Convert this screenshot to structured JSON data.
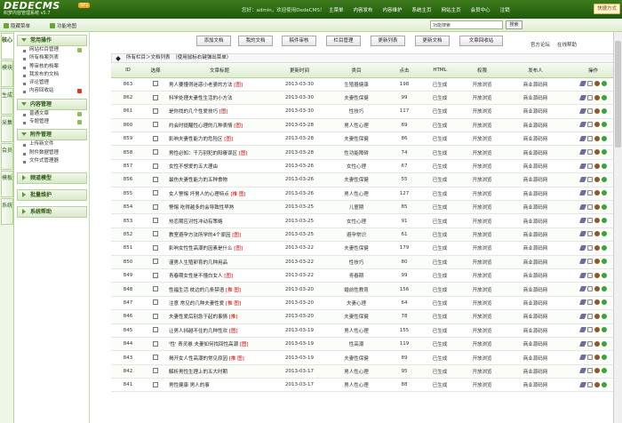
{
  "app": {
    "logo_main": "DEDECMS",
    "logo_sub": "织梦内容管理系统 v5.7",
    "logo_badge": "SP1"
  },
  "header": {
    "welcome": "您好：admin，欢迎使用DedeCMS！",
    "nav": [
      "主菜单",
      "内容发布",
      "内容维护",
      "系统主页",
      "网站主页",
      "会员中心",
      "注销"
    ],
    "quick_label": "快捷方式"
  },
  "subbar": {
    "hide_menu": "隐藏菜单",
    "function_map": "功能地图",
    "search_value": "功能搜索",
    "search_button": "搜索",
    "official_forum": "官方论坛",
    "dede_wiki": "在线帮助"
  },
  "vtabs": [
    "核心",
    "模块",
    "生成",
    "采集",
    "会员",
    "模板",
    "系统"
  ],
  "sidebar": {
    "sections": [
      {
        "title": "常用操作",
        "items": [
          "网站栏目管理",
          "所有档案列表",
          "等审核的档案",
          "我发布的文档",
          "评论管理",
          "内容回收站"
        ]
      },
      {
        "title": "内容管理",
        "items": [
          "普通文章",
          "专题管理"
        ]
      },
      {
        "title": "附件管理",
        "items": [
          "上传新文件",
          "附件数据管理",
          "文件式管理器"
        ]
      },
      {
        "title": "频道模型",
        "items": []
      },
      {
        "title": "批量维护",
        "items": []
      },
      {
        "title": "系统帮助",
        "items": []
      }
    ]
  },
  "toolbar": {
    "buttons": [
      "添加文档",
      "我的文档",
      "稿件审核",
      "栏目管理",
      "更新列表",
      "更新文档",
      "文章回收站"
    ]
  },
  "crumb": "所有栏目＞文档列表　（使用鼠标右键弹出菜单）",
  "table": {
    "headers": [
      "ID",
      "选择",
      "文章标题",
      "更新时间",
      "类目",
      "点击",
      "HTML",
      "权限",
      "发布人",
      "操作"
    ],
    "rows": [
      {
        "id": "863",
        "title": "男人要懂得迷惑小老婆的方法",
        "flag": "[图]",
        "date": "2013-03-30",
        "cat": "生殖器健康",
        "hits": "198",
        "html": "已生成",
        "perm": "开放浏览",
        "author": "商业源码网"
      },
      {
        "id": "862",
        "title": "科学处理夫妻性生活的小方法",
        "flag": "",
        "date": "2013-03-30",
        "cat": "夫妻性保健",
        "hits": "99",
        "html": "已生成",
        "perm": "开放浏览",
        "author": "商业源码网"
      },
      {
        "id": "861",
        "title": "是你找的几个性爱技巧",
        "flag": "[图]",
        "date": "2013-03-30",
        "cat": "性技巧",
        "hits": "117",
        "html": "已生成",
        "perm": "开放浏览",
        "author": "商业源码网"
      },
      {
        "id": "860",
        "title": "约会时提醒性心理的几种表情",
        "flag": "[图]",
        "date": "2013-03-28",
        "cat": "男人性心理",
        "hits": "69",
        "html": "已生成",
        "perm": "开放浏览",
        "author": "商业源码网"
      },
      {
        "id": "859",
        "title": "影响夫妻性能力的危险区",
        "flag": "[图]",
        "date": "2013-03-28",
        "cat": "夫妻性保健",
        "hits": "86",
        "html": "已生成",
        "perm": "开放浏览",
        "author": "商业源码网"
      },
      {
        "id": "858",
        "title": "男性必知：千万别犯的阳痿误区",
        "flag": "[图]",
        "date": "2013-03-28",
        "cat": "性功能障碍",
        "hits": "74",
        "html": "已生成",
        "perm": "开放浏览",
        "author": "商业源码网"
      },
      {
        "id": "857",
        "title": "女性不想爱的五大理由",
        "flag": "",
        "date": "2013-03-26",
        "cat": "女性心理",
        "hits": "67",
        "html": "已生成",
        "perm": "开放浏览",
        "author": "商业源码网"
      },
      {
        "id": "856",
        "title": "最伤夫妻性能力的五种食物",
        "flag": "",
        "date": "2013-03-26",
        "cat": "夫妻性保健",
        "hits": "55",
        "html": "已生成",
        "perm": "开放浏览",
        "author": "商业源码网"
      },
      {
        "id": "855",
        "title": "女人警惕 坏男人的心理特点",
        "flag": "[推 图]",
        "date": "2013-03-26",
        "cat": "男人性心理",
        "hits": "127",
        "html": "已生成",
        "perm": "开放浏览",
        "author": "商业源码网"
      },
      {
        "id": "854",
        "title": "警惕 吃得越多的会导致性早熟",
        "flag": "",
        "date": "2013-03-25",
        "cat": "儿童期",
        "hits": "85",
        "html": "已生成",
        "perm": "开放浏览",
        "author": "商业源码网"
      },
      {
        "id": "853",
        "title": "热恋期应对性冲动有策略",
        "flag": "",
        "date": "2013-03-25",
        "cat": "女性心理",
        "hits": "91",
        "html": "已生成",
        "perm": "开放浏览",
        "author": "商业源码网"
      },
      {
        "id": "852",
        "title": "教室避孕方法所学的4个原因",
        "flag": "[图]",
        "date": "2013-03-25",
        "cat": "避孕常识",
        "hits": "61",
        "html": "已生成",
        "perm": "开放浏览",
        "author": "商业源码网"
      },
      {
        "id": "851",
        "title": "影响女性性高潮的因素是什么",
        "flag": "[图]",
        "date": "2013-03-22",
        "cat": "夫妻性保健",
        "hits": "179",
        "html": "已生成",
        "perm": "开放浏览",
        "author": "商业源码网"
      },
      {
        "id": "850",
        "title": "谨男人生殖卵育的几种用品",
        "flag": "",
        "date": "2013-03-22",
        "cat": "性技巧",
        "hits": "80",
        "html": "已生成",
        "perm": "开放浏览",
        "author": "商业源码网"
      },
      {
        "id": "849",
        "title": "青春期女性是不懂白女人",
        "flag": "[图]",
        "date": "2013-03-22",
        "cat": "青春期",
        "hits": "99",
        "html": "已生成",
        "perm": "开放浏览",
        "author": "商业源码网"
      },
      {
        "id": "848",
        "title": "性福生活 枕边的几条禁语",
        "flag": "[推 图]",
        "date": "2013-03-20",
        "cat": "婚前性教育",
        "hits": "156",
        "html": "已生成",
        "perm": "开放浏览",
        "author": "商业源码网"
      },
      {
        "id": "847",
        "title": "注意 常见的几种夫妻性爱",
        "flag": "[推 图]",
        "date": "2013-03-20",
        "cat": "夫妻心理",
        "hits": "64",
        "html": "已生成",
        "perm": "开放浏览",
        "author": "商业源码网"
      },
      {
        "id": "846",
        "title": "夫妻性爱后别急于起的事情",
        "flag": "[推]",
        "date": "2013-03-20",
        "cat": "夫妻性保健",
        "hits": "78",
        "html": "已生成",
        "perm": "开放浏览",
        "author": "商业源码网"
      },
      {
        "id": "845",
        "title": "让男人挡越不住的几种性欢",
        "flag": "[图]",
        "date": "2013-03-19",
        "cat": "男人性心理",
        "hits": "155",
        "html": "已生成",
        "perm": "开放浏览",
        "author": "商业源码网"
      },
      {
        "id": "844",
        "title": "'性' 青灵悬 夫妻如何找回性高潮",
        "flag": "[图]",
        "date": "2013-03-19",
        "cat": "性高潮",
        "hits": "119",
        "html": "已生成",
        "perm": "开放浏览",
        "author": "商业源码网"
      },
      {
        "id": "843",
        "title": "揭开女人性高潮的常见原因",
        "flag": "[推 图]",
        "date": "2013-03-19",
        "cat": "夫妻性保健",
        "hits": "89",
        "html": "已生成",
        "perm": "开放浏览",
        "author": "商业源码网"
      },
      {
        "id": "842",
        "title": "解析男性生理上的五大时期",
        "flag": "",
        "date": "2013-03-17",
        "cat": "男人性心理",
        "hits": "95",
        "html": "已生成",
        "perm": "开放浏览",
        "author": "商业源码网"
      },
      {
        "id": "841",
        "title": "男性健康 男人的事",
        "flag": "",
        "date": "2013-03-17",
        "cat": "男人性心理",
        "hits": "88",
        "html": "已生成",
        "perm": "开放浏览",
        "author": "商业源码网"
      }
    ]
  }
}
